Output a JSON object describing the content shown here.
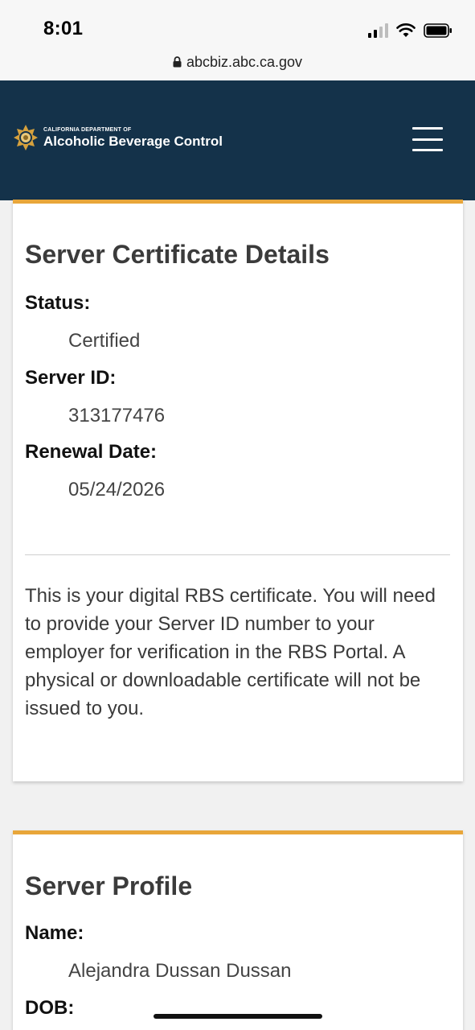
{
  "status_bar": {
    "time": "8:01",
    "icons": [
      "cellular-signal-icon",
      "wifi-icon",
      "battery-icon"
    ]
  },
  "browser": {
    "url": "abcbiz.abc.ca.gov",
    "lock_icon": "lock-icon"
  },
  "header": {
    "logo_small": "California Department of",
    "logo_big": "Alcoholic Beverage Control",
    "logo_icon": "badge-star-icon",
    "menu_icon": "hamburger-menu-icon",
    "background": "#14324a"
  },
  "certificate": {
    "title": "Server Certificate Details",
    "status_label": "Status:",
    "status_value": "Certified",
    "server_id_label": "Server ID:",
    "server_id_value": "313177476",
    "renewal_label": "Renewal Date:",
    "renewal_value": "05/24/2026",
    "note": "This is your digital RBS certificate. You will need to provide your Server ID number to your employer for verification in the RBS Portal. A physical or downloadable certificate will not be issued to you.",
    "accent": "#e8a63a"
  },
  "profile": {
    "title": "Server Profile",
    "name_label": "Name:",
    "name_value": "Alejandra Dussan Dussan",
    "dob_label": "DOB:"
  }
}
